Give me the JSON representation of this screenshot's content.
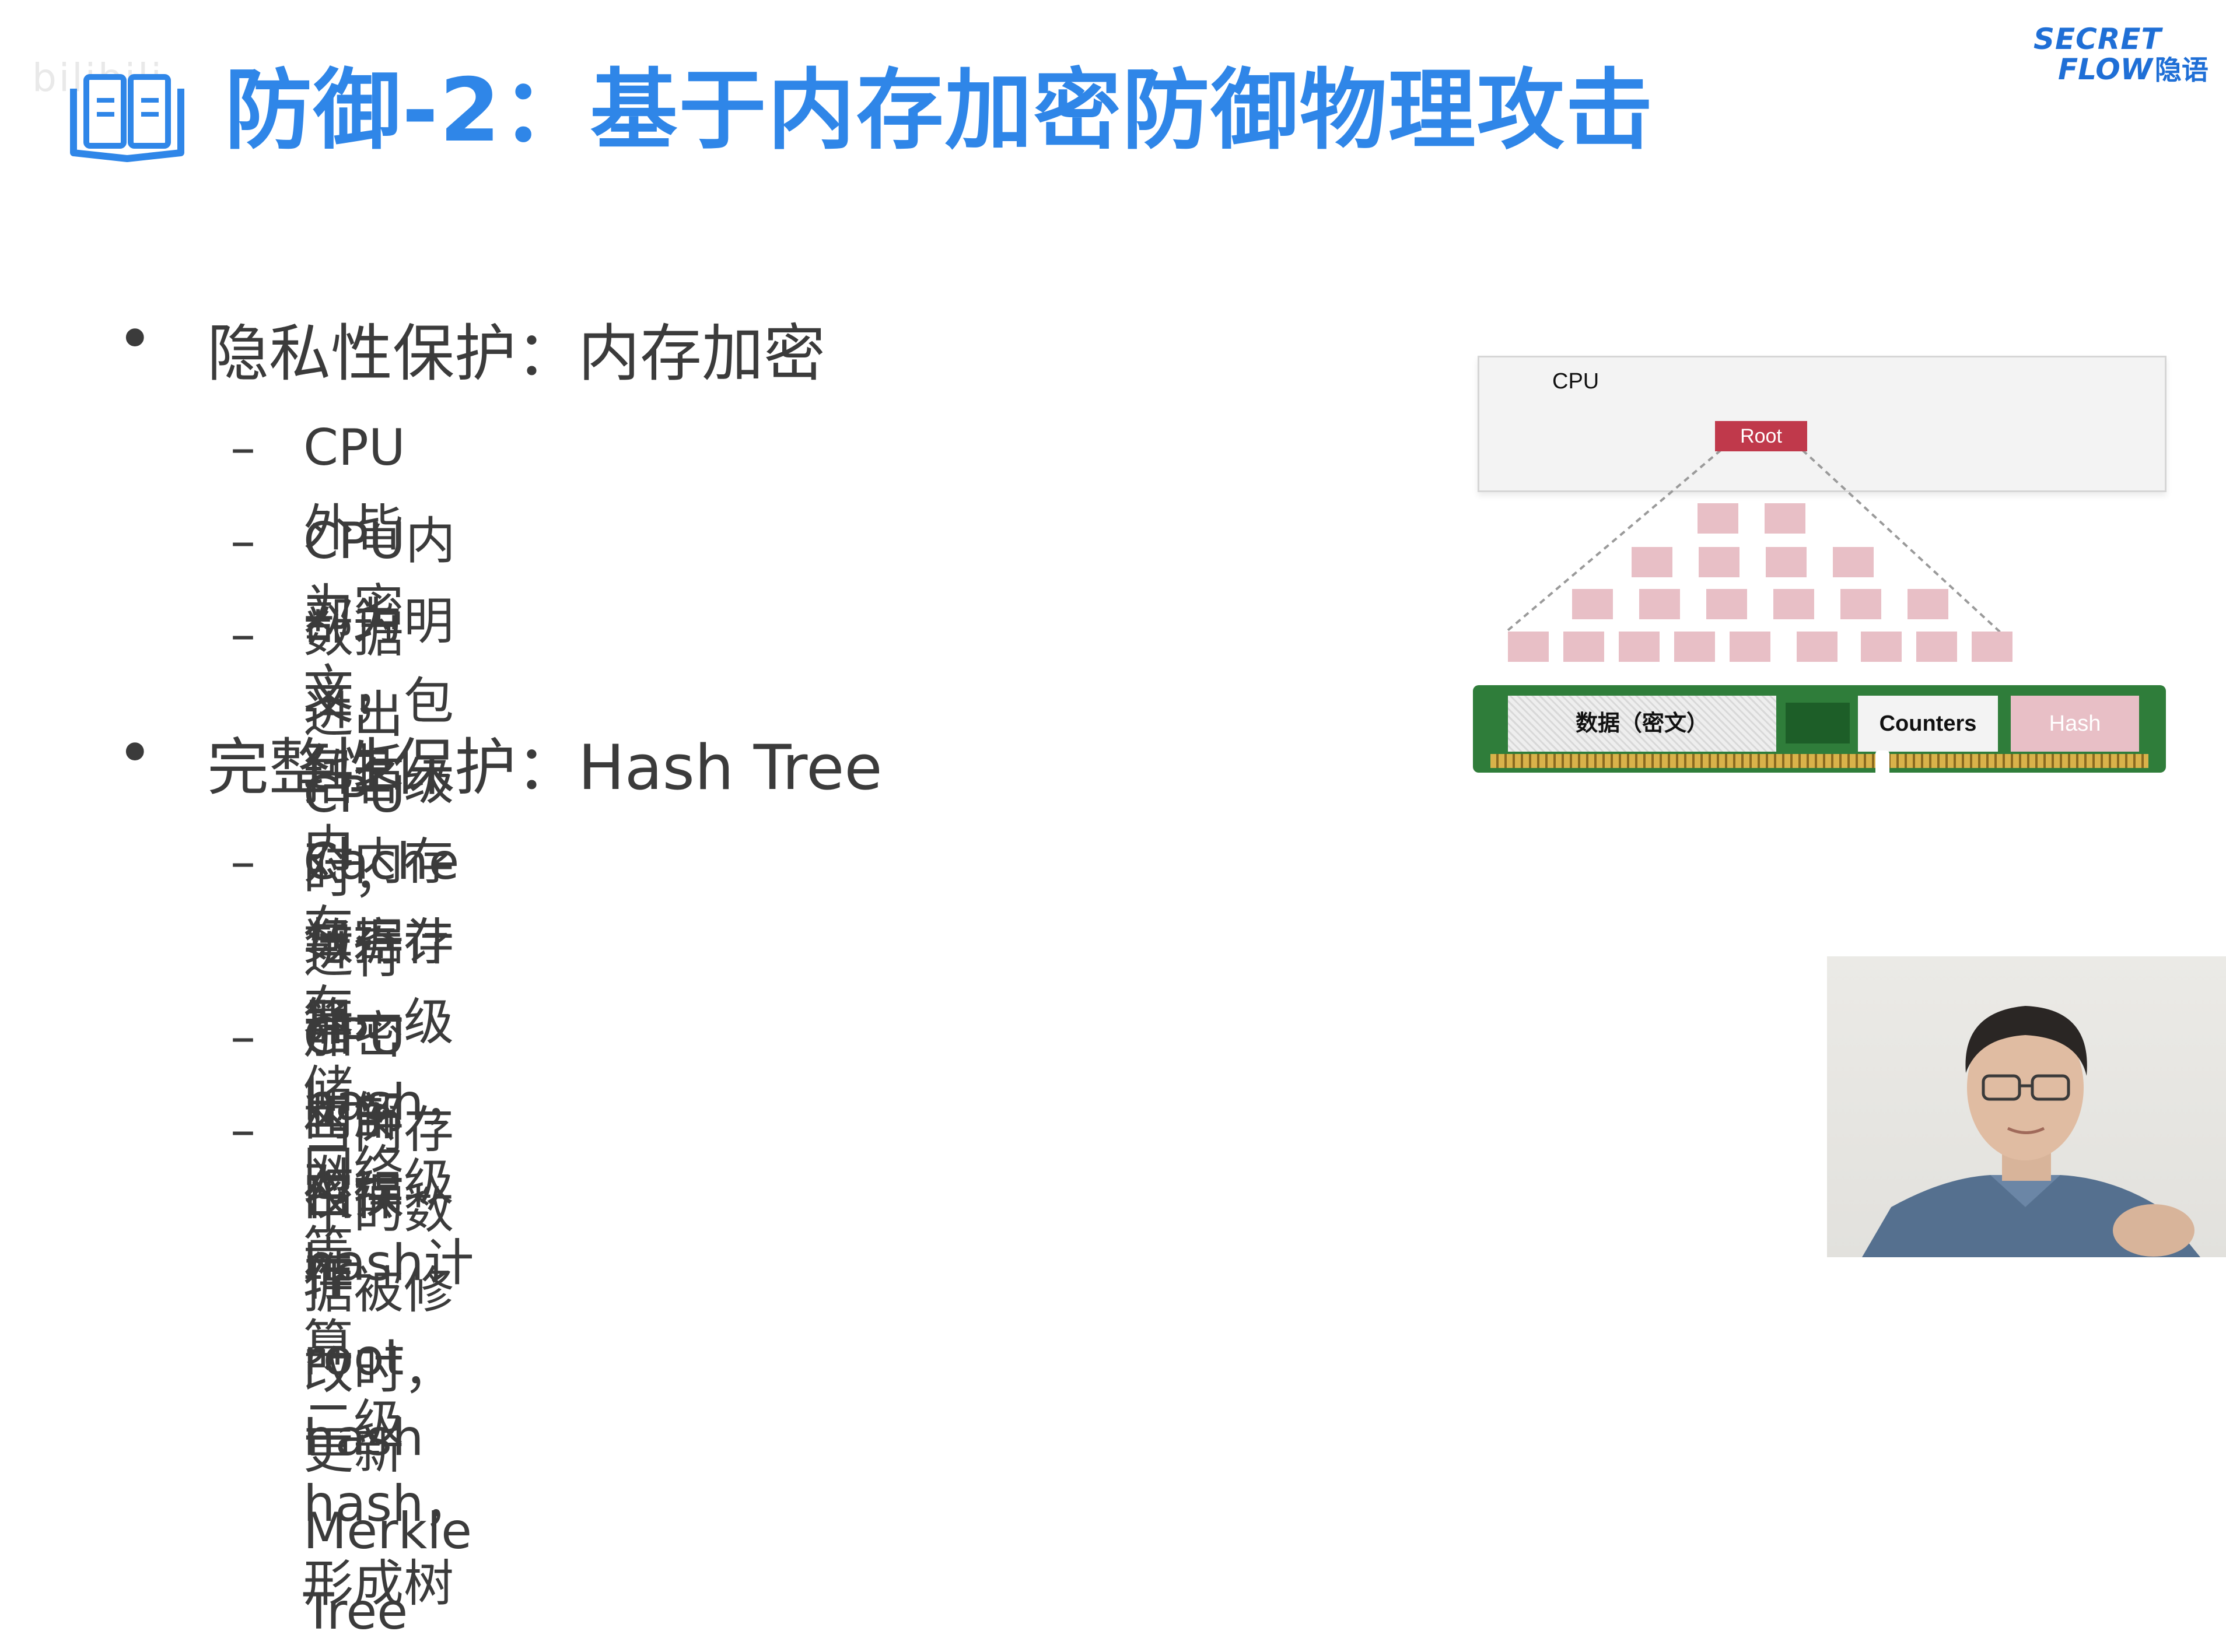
{
  "watermark": "bilibili",
  "title": "防御-2：基于内存加密防御物理攻击",
  "logo": {
    "line1": "SECRET",
    "line2": "FLOW",
    "cn": "隐语"
  },
  "bullets": [
    {
      "text": "隐私性保护：内存加密",
      "subs": [
        "CPU外皆为密文，包括内存、存储、网络等",
        "CPU内部为明文，包括各级Cache与寄存器",
        "数据进出CPU时，进行加密和解密操作"
      ]
    },
    {
      "text": "完整性保护：Hash Tree",
      "subs": [
        "对内存数据计算一级hash，对一级hash计算\n二级hash，形成树",
        "CPU内部仅保存root hash",
        "当内存中的数据被修改时，更新Merkle Tree"
      ]
    }
  ],
  "symbols": {
    "bullet": "•",
    "dash": "–"
  },
  "diagram": {
    "cpu_label": "CPU",
    "root_label": "Root",
    "memory": {
      "data": "数据（密文）",
      "counters": "Counters",
      "hash": "Hash"
    }
  },
  "colors": {
    "title": "#2f86e8",
    "root": "#c0394b",
    "node": "#e8bfc6",
    "dimm": "#2f7d3a"
  }
}
